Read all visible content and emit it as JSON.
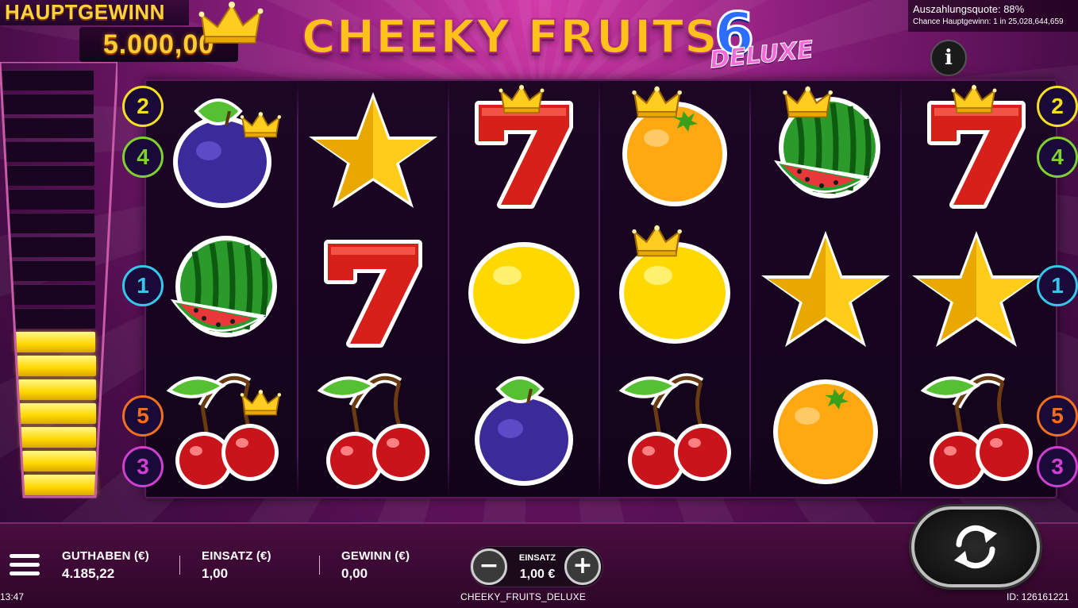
{
  "jackpot": {
    "label": "HAUPTGEWINN",
    "value": "5.000,00",
    "meter_filled_steps": 7,
    "meter_total_steps": 18
  },
  "title": {
    "main": "CHEEKY FRUITS",
    "number": "6",
    "edition": "DELUXE"
  },
  "info": {
    "rtp": "Auszahlungsquote: 88%",
    "chance": "Chance Hauptgewinn: 1 in 25,028,644,659",
    "button": "i"
  },
  "reels": [
    [
      {
        "symbol": "plum",
        "crown": true
      },
      {
        "symbol": "watermelon",
        "crown": false
      },
      {
        "symbol": "cherry",
        "crown": true
      }
    ],
    [
      {
        "symbol": "star",
        "crown": false
      },
      {
        "symbol": "seven",
        "crown": false
      },
      {
        "symbol": "cherry",
        "crown": false
      }
    ],
    [
      {
        "symbol": "seven",
        "crown": true
      },
      {
        "symbol": "lemon",
        "crown": false
      },
      {
        "symbol": "plum",
        "crown": false
      }
    ],
    [
      {
        "symbol": "orange",
        "crown": true
      },
      {
        "symbol": "lemon",
        "crown": true
      },
      {
        "symbol": "cherry",
        "crown": false
      }
    ],
    [
      {
        "symbol": "watermelon",
        "crown": true
      },
      {
        "symbol": "star",
        "crown": false
      },
      {
        "symbol": "orange",
        "crown": false
      }
    ],
    [
      {
        "symbol": "seven",
        "crown": true
      },
      {
        "symbol": "star",
        "crown": false
      },
      {
        "symbol": "cherry",
        "crown": false
      }
    ]
  ],
  "lines_left": [
    {
      "label": "2",
      "color": "#f5e020"
    },
    {
      "label": "4",
      "color": "#7fd030"
    },
    {
      "label": "1",
      "color": "#35c8e8"
    },
    {
      "label": "5",
      "color": "#f07020"
    },
    {
      "label": "3",
      "color": "#d040d0"
    }
  ],
  "lines_right": [
    {
      "label": "2",
      "color": "#f5e020"
    },
    {
      "label": "4",
      "color": "#7fd030"
    },
    {
      "label": "1",
      "color": "#35c8e8"
    },
    {
      "label": "5",
      "color": "#f07020"
    },
    {
      "label": "3",
      "color": "#d040d0"
    }
  ],
  "bottom": {
    "balance_label": "GUTHABEN (€)",
    "balance_value": "4.185,22",
    "stake_label": "EINSATZ (€)",
    "stake_value": "1,00",
    "win_label": "GEWINN (€)",
    "win_value": "0,00",
    "bet_control_label": "EINSATZ",
    "bet_control_value": "1,00 €",
    "minus": "−",
    "plus": "+"
  },
  "footer": {
    "clock": "13:47",
    "game_name": "CHEEKY_FRUITS_DELUXE",
    "game_id": "ID: 126161221"
  },
  "icons": {
    "menu": "hamburger-menu-icon",
    "spin": "spin-arrows-icon",
    "info": "info-icon"
  }
}
